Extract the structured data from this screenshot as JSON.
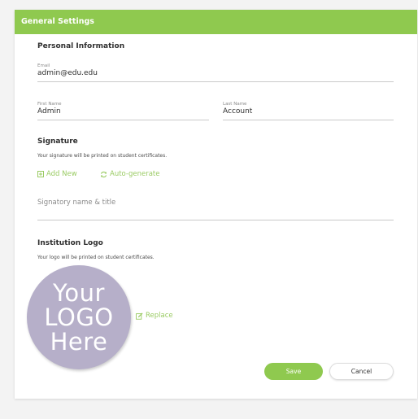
{
  "header": {
    "title": "General Settings"
  },
  "personal": {
    "title": "Personal Information",
    "email": {
      "label": "Email",
      "value": "admin@edu.edu"
    },
    "first_name": {
      "label": "First Name",
      "value": "Admin"
    },
    "last_name": {
      "label": "Last Name",
      "value": "Account"
    }
  },
  "signature": {
    "title": "Signature",
    "description": "Your signature will be printed on student certificates.",
    "add_new_label": "Add New",
    "auto_generate_label": "Auto-generate",
    "signatory_placeholder": "Signatory name & title"
  },
  "logo": {
    "title": "Institution Logo",
    "description": "Your logo will be printed on student certificates.",
    "image_text": [
      "Your",
      "LOGO",
      "Here"
    ],
    "replace_label": "Replace"
  },
  "actions": {
    "save_label": "Save",
    "cancel_label": "Cancel"
  },
  "colors": {
    "accent": "#8fc94f",
    "link": "#9acb63",
    "logo_bg": "#b6afc9"
  }
}
